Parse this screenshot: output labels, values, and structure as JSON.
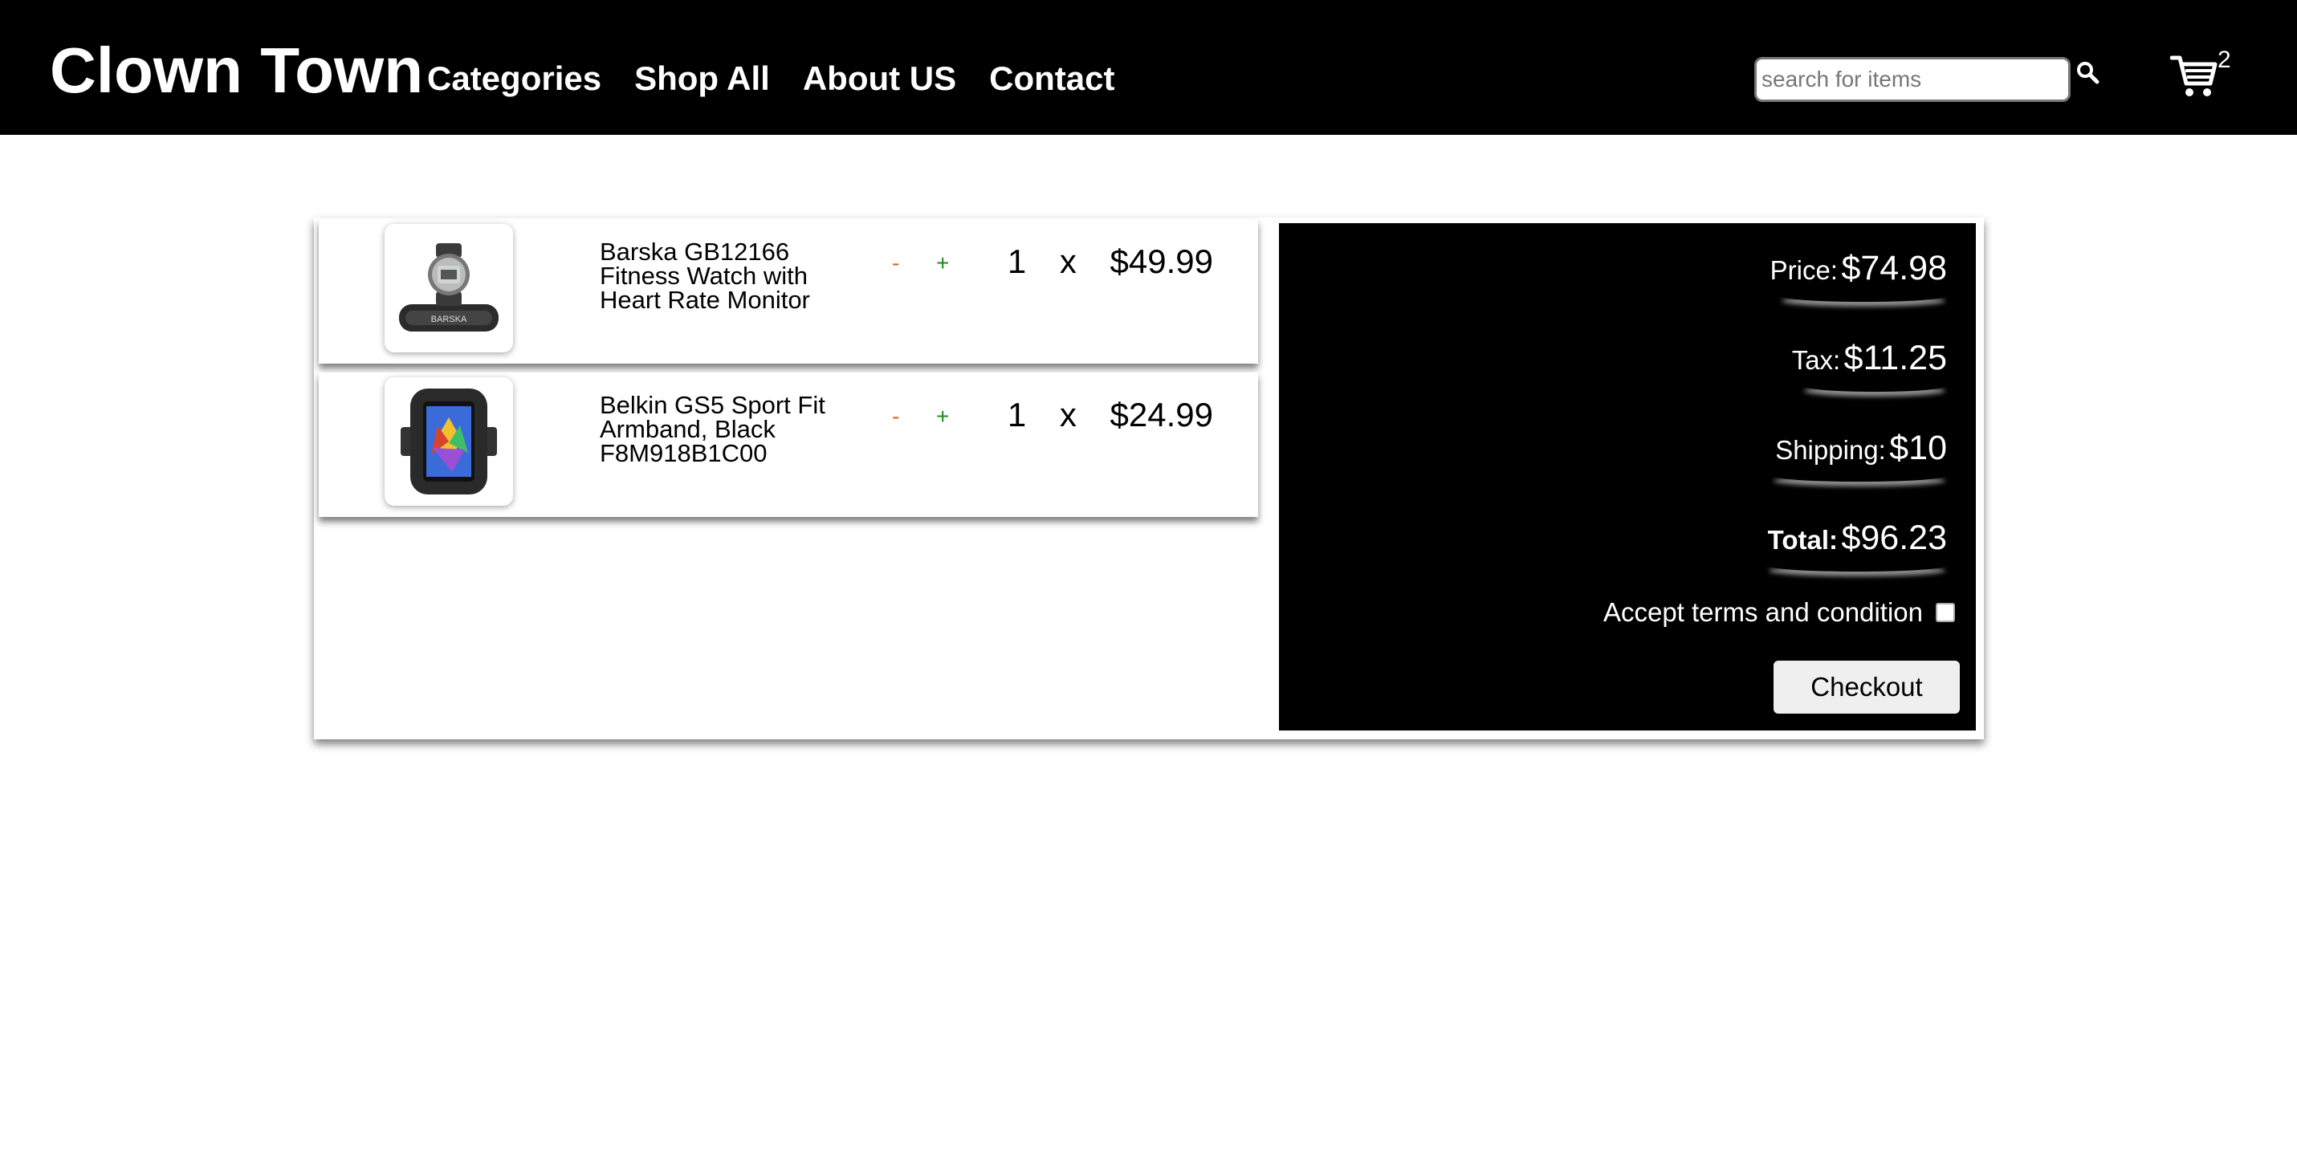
{
  "header": {
    "brand": "Clown Town",
    "nav": [
      "Categories",
      "Shop All",
      "About US",
      "Contact"
    ],
    "search_placeholder": "search for items",
    "cart_count": "2"
  },
  "cart": {
    "items": [
      {
        "name": "Barska GB12166 Fitness Watch with Heart Rate Monitor",
        "minus": "-",
        "plus": "+",
        "qty": "1",
        "times": "x",
        "price": "$49.99",
        "thumb_icon": "fitness-watch-image"
      },
      {
        "name": "Belkin GS5 Sport Fit Armband, Black F8M918B1C00",
        "minus": "-",
        "plus": "+",
        "qty": "1",
        "times": "x",
        "price": "$24.99",
        "thumb_icon": "armband-image"
      }
    ]
  },
  "summary": {
    "price_label": "Price:",
    "price_value": "$74.98",
    "tax_label": "Tax:",
    "tax_value": "$11.25",
    "shipping_label": "Shipping:",
    "shipping_value": "$10",
    "total_label": "Total:",
    "total_value": "$96.23",
    "terms_label": "Accept terms and condition",
    "checkout_label": "Checkout"
  },
  "colors": {
    "header_bg": "#000000",
    "minus": "#d2691e",
    "plus": "#228b22"
  }
}
